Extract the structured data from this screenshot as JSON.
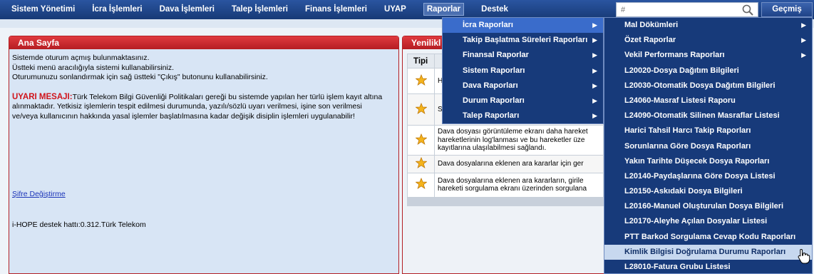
{
  "nav": {
    "items": [
      {
        "label": "Sistem Yönetimi"
      },
      {
        "label": "İcra İşlemleri"
      },
      {
        "label": "Dava İşlemleri"
      },
      {
        "label": "Talep İşlemleri"
      },
      {
        "label": "Finans İşlemleri"
      },
      {
        "label": "UYAP"
      },
      {
        "label": "Raporlar"
      },
      {
        "label": "Destek"
      }
    ],
    "search_placeholder": "#",
    "history_label": "Geçmiş"
  },
  "home_panel": {
    "title": "Ana Sayfa",
    "line1": "Sistemde oturum açmış bulunmaktasınız.",
    "line2": "Üstteki menü aracılığıyla sistemi kullanabilirsiniz.",
    "line3": "Oturumunuzu sonlandırmak için sağ üstteki \"Çıkış\" butonunu kullanabilirsiniz.",
    "warning_title": "UYARI MESAJI:",
    "warning_text": "Türk Telekom Bilgi Güvenliği Politikaları gereği bu sistemde yapılan her türlü işlem kayıt altına alınmaktadır. Yetkisiz işlemlerin tespit edilmesi durumunda, yazılı/sözlü uyarı verilmesi, işine son verilmesi ve/veya kullanıcının hakkında yasal işlemler başlatılmasına kadar değişik disiplin işlemleri uygulanabilir!",
    "password_link": "Şifre Değiştirme",
    "hotline": "i-HOPE destek hattı:0.312.Türk Telekom"
  },
  "news_panel": {
    "title": "Yenilikl",
    "col_type": "Tipi",
    "rows": [
      {
        "text": "H"
      },
      {
        "text": "S"
      },
      {
        "text": "Dava dosyası görüntüleme ekranı daha hareket hareketlerinin log'lanması ve bu hareketler üze kayıtlarına ulaşılabilmesi sağlandı."
      },
      {
        "text": "Dava dosyalarına eklenen ara kararlar için ger"
      },
      {
        "text": "Dava dosyalarına eklenen ara kararların, girile hareketi sorgulama ekranı üzerinden sorgulana"
      }
    ]
  },
  "menu_reports": {
    "items": [
      {
        "label": "İcra Raporları"
      },
      {
        "label": "Takip Başlatma Süreleri Raporları"
      },
      {
        "label": "Finansal Raporlar"
      },
      {
        "label": "Sistem Raporları"
      },
      {
        "label": "Dava Raporları"
      },
      {
        "label": "Durum Raporları"
      },
      {
        "label": "Talep Raporları"
      }
    ]
  },
  "menu_icra": {
    "items": [
      {
        "label": "Mal Dökümleri"
      },
      {
        "label": "Özet Raporlar"
      },
      {
        "label": "Vekil Performans Raporları"
      },
      {
        "label": "L20020-Dosya Dağıtım Bilgileri"
      },
      {
        "label": "L20030-Otomatik Dosya Dağıtım Bilgileri"
      },
      {
        "label": "L24060-Masraf Listesi Raporu"
      },
      {
        "label": "L24090-Otomatik Silinen Masraflar Listesi"
      },
      {
        "label": "Harici Tahsil Harcı Takip Raporları"
      },
      {
        "label": "Sorunlarına Göre Dosya Raporları"
      },
      {
        "label": "Yakın Tarihte Düşecek Dosya Raporları"
      },
      {
        "label": "L20140-Paydaşlarına Göre Dosya Listesi"
      },
      {
        "label": "L20150-Askıdaki Dosya Bilgileri"
      },
      {
        "label": "L20160-Manuel Oluşturulan Dosya Bilgileri"
      },
      {
        "label": "L20170-Aleyhe Açılan Dosyalar Listesi"
      },
      {
        "label": "PTT Barkod Sorgulama Cevap Kodu Raporları"
      },
      {
        "label": "Kimlik Bilgisi Doğrulama Durumu Raporları"
      },
      {
        "label": "L28010-Fatura Grubu Listesi"
      }
    ]
  },
  "colors": {
    "nav_bg": "#1b3d7a",
    "panel_red": "#c8242a",
    "menu_bg": "#173a7a",
    "menu_highlight": "#3a6ccb",
    "menu_hover": "#c7d8ef"
  }
}
